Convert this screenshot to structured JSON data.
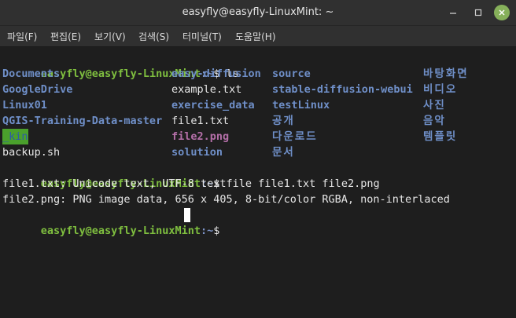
{
  "window": {
    "title": "easyfly@easyfly-LinuxMint: ~"
  },
  "menu": [
    {
      "label": "파일(F)"
    },
    {
      "label": "편집(E)"
    },
    {
      "label": "보기(V)"
    },
    {
      "label": "검색(S)"
    },
    {
      "label": "터미널(T)"
    },
    {
      "label": "도움말(H)"
    }
  ],
  "terminal": {
    "prompt_user": "easyfly@easyfly-LinuxMint",
    "prompt_path": ":~",
    "prompt_symbol": "$ ",
    "cmd1": "ls",
    "ls": {
      "col1": [
        "Documents",
        "GoogleDrive",
        "Linux01",
        "QGIS-Training-Data-master",
        "_kin",
        "backup.sh"
      ],
      "col2": [
        "easy-diffusion",
        "example.txt",
        "exercise_data",
        "file1.txt",
        "file2.png",
        "solution"
      ],
      "col3": [
        "source",
        "stable-diffusion-webui",
        "testLinux",
        "공개",
        "다운로드",
        "문서"
      ],
      "col4": [
        "바탕화면",
        "비디오",
        "사진",
        "음악",
        "템플릿"
      ]
    },
    "cmd2": "file file1.txt file2.png",
    "output1": "file1.txt: Unicode text, UTF-8 text",
    "output2": "file2.png: PNG image data, 656 x 405, 8-bit/color RGBA, non-interlaced"
  },
  "colors": {
    "prompt_user": "#7fbf3f",
    "directory": "#6f8fc8",
    "image_file": "#b46fa8",
    "close_button": "#86b05a"
  }
}
